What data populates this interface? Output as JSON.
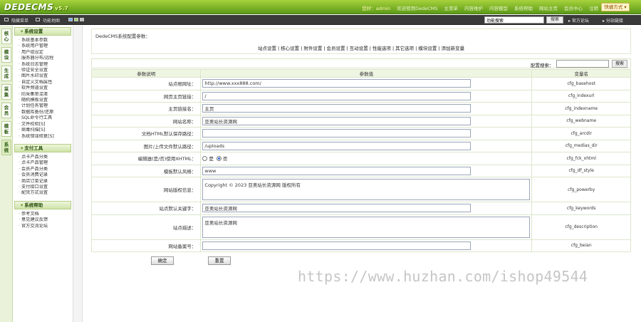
{
  "app": {
    "logo": "DEDECMS",
    "version": "v5.7"
  },
  "top_nav": {
    "user_text": "您好：admin",
    "items": [
      "欢迎使用DedeCMS",
      "主菜单",
      "内容维护",
      "内容模型",
      "系统帮助",
      "网站主页",
      "会员中心",
      "注销"
    ],
    "quick_button": "快捷方式 ▾"
  },
  "bar2": {
    "links": [
      "隐藏菜单",
      "功能地图"
    ],
    "search_value": "功能搜索",
    "search_button": "搜索",
    "right_links": [
      "官方论坛",
      "分站链接"
    ]
  },
  "vtabs": [
    "核心",
    "模块",
    "生成",
    "采集",
    "会员",
    "模板",
    "系统"
  ],
  "sidebar": {
    "groups": [
      {
        "title": "系统设置",
        "items": [
          "系统基本参数",
          "系统用户管理",
          "用户组设定",
          "服务器分布/远程",
          "系统日志管理",
          "验证安全设置",
          "图片水印设置",
          "自定义文档属性",
          "软件频道设置",
          "防采集串混淆",
          "随机模板设置",
          "计划任务管理",
          "数据库备份/还原",
          "SQL命令行工具",
          "文件校验[S]",
          "病毒扫描[S]",
          "系统错误修复[S]"
        ]
      },
      {
        "title": "支付工具",
        "items": [
          "点卡产品分类",
          "点卡产品管理",
          "会员产品分类",
          "会员消费记录",
          "商店订单记录",
          "支付接口设置",
          "配货方式设置"
        ]
      },
      {
        "title": "系统帮助",
        "items": [
          "参考文档",
          "意见建议反馈",
          "官方交流论坛"
        ]
      }
    ]
  },
  "main": {
    "title": "DedeCMS系统配置参数：",
    "subnav": [
      "站点设置",
      "核心设置",
      "附件设置",
      "会员设置",
      "互动设置",
      "性能选项",
      "其它选项",
      "模块设置",
      "添加新变量"
    ],
    "filter_label": "配置搜索：",
    "filter_button": "搜索",
    "columns": [
      "参数说明",
      "参数值",
      "变量名"
    ],
    "rows": [
      {
        "label": "站点根网址：",
        "type": "text",
        "value": "http://www.xxx888.com/",
        "var": "cfg_basehost"
      },
      {
        "label": "网页主页链接：",
        "type": "text",
        "value": "/",
        "var": "cfg_indexurl"
      },
      {
        "label": "主页链接名：",
        "type": "text",
        "value": "主页",
        "var": "cfg_indexname"
      },
      {
        "label": "网站名称：",
        "type": "text",
        "value": "亚奥站长资源网",
        "var": "cfg_webname"
      },
      {
        "label": "文档HTML默认保存路径：",
        "type": "text",
        "value": "",
        "var": "cfg_arcdir"
      },
      {
        "label": "图片/上传文件默认路径：",
        "type": "text",
        "value": "/uploads",
        "var": "cfg_medias_dir"
      },
      {
        "label": "编辑器(是/否)使用XHTML：",
        "type": "radio",
        "options": [
          "是",
          "否"
        ],
        "selected": 1,
        "var": "cfg_fck_xhtml"
      },
      {
        "label": "模板默认风格：",
        "type": "text",
        "value": "www",
        "var": "cfg_df_style"
      },
      {
        "label": "网站版权信息：",
        "type": "textarea",
        "value": "Copyright &copy; 2023 亚奥站长资源网 版权所有",
        "var": "cfg_powerby"
      },
      {
        "label": "站点默认关键字：",
        "type": "text",
        "value": "亚奥站长资源网",
        "var": "cfg_keywords"
      },
      {
        "label": "站点描述：",
        "type": "textarea",
        "value": "亚奥站长资源网",
        "var": "cfg_description"
      },
      {
        "label": "网站备案号：",
        "type": "text",
        "value": "",
        "var": "cfg_beian"
      }
    ],
    "save_button": "确定",
    "reset_button": "重置"
  },
  "watermark": "https://www.huzhan.com/ishop49544"
}
